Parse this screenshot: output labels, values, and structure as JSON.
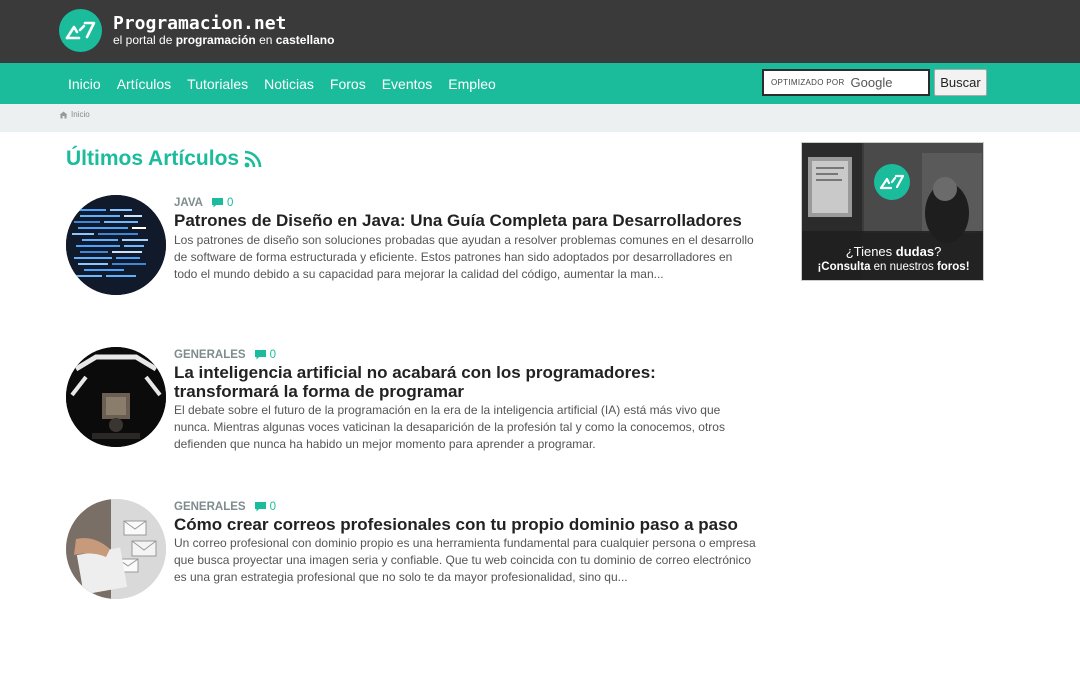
{
  "header": {
    "site_name": "Programacion.net",
    "tagline_pre": "el portal de ",
    "tagline_bold1": "programación",
    "tagline_mid": " en ",
    "tagline_bold2": "castellano"
  },
  "nav": {
    "items": [
      "Inicio",
      "Artículos",
      "Tutoriales",
      "Noticias",
      "Foros",
      "Eventos",
      "Empleo"
    ]
  },
  "search": {
    "powered_by": "OPTIMIZADO POR",
    "provider": "Google",
    "button_label": "Buscar"
  },
  "breadcrumb": {
    "home": "Inicio"
  },
  "section": {
    "title": "Últimos Artículos"
  },
  "articles": [
    {
      "category": "JAVA",
      "comments": "0",
      "title": "Patrones de Diseño en Java: Una Guía Completa para Desarrolladores",
      "excerpt": "Los patrones de diseño son soluciones probadas que ayudan a resolver problemas comunes en el desarrollo de software de forma estructurada y eficiente. Estos patrones han sido adoptados por desarrolladores en todo el mundo debido a su capacidad para mejorar la calidad del código, aumentar la man..."
    },
    {
      "category": "GENERALES",
      "comments": "0",
      "title": "La inteligencia artificial no acabará con los programadores: transformará la forma de programar",
      "excerpt": "El debate sobre el futuro de la programación en la era de la inteligencia artificial (IA) está más vivo que nunca. Mientras algunas voces vaticinan la desaparición de la profesión tal y como la conocemos, otros defienden que nunca ha habido un mejor momento para aprender a programar."
    },
    {
      "category": "GENERALES",
      "comments": "0",
      "title": "Cómo crear correos profesionales con tu propio dominio paso a paso",
      "excerpt": "Un correo profesional con dominio propio es una herramienta fundamental para cualquier persona o empresa que busca proyectar una imagen seria y confiable. Que tu web coincida con tu dominio de correo electrónico es una gran estrategia profesional que no solo te da mayor profesionalidad, sino qu..."
    }
  ],
  "ad": {
    "line1_pre": "¿Tienes ",
    "line1_bold": "dudas",
    "line1_post": "?",
    "line2_pre": "¡Consulta",
    "line2_mid": " en nuestros ",
    "line2_bold": "foros",
    "line2_post": "!"
  },
  "colors": {
    "brand": "#1abc9c",
    "topbar": "#3a3a3b",
    "breadcrumb_bg": "#ecf0f1"
  }
}
